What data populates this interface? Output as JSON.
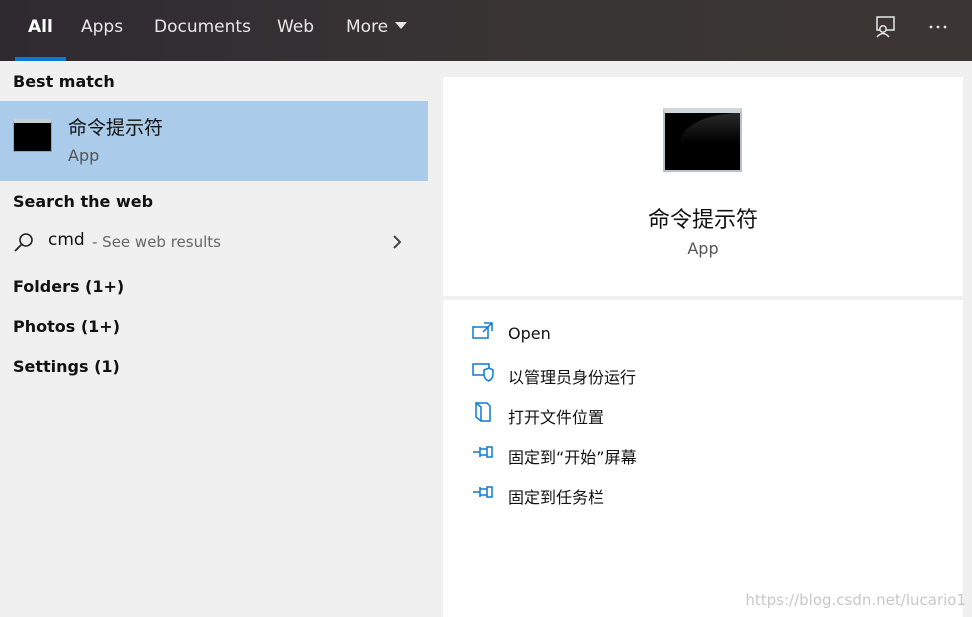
{
  "tabs": [
    {
      "label": "All",
      "active": true
    },
    {
      "label": "Apps"
    },
    {
      "label": "Documents"
    },
    {
      "label": "Web"
    },
    {
      "label": "More"
    }
  ],
  "top_icons": [
    "feedback-icon",
    "more-options-icon"
  ],
  "left": {
    "best_match_heading": "Best match",
    "best_match": {
      "title": "命令提示符",
      "subtitle": "App"
    },
    "web_heading": "Search the web",
    "web_result": {
      "query": "cmd",
      "hint": "- See web results"
    },
    "groups": [
      "Folders (1+)",
      "Photos (1+)",
      "Settings (1)"
    ]
  },
  "detail": {
    "title": "命令提示符",
    "subtitle": "App",
    "actions": [
      {
        "label": "Open",
        "icon": "open-icon"
      },
      {
        "label": "以管理员身份运行",
        "icon": "run-as-admin-icon"
      },
      {
        "label": "打开文件位置",
        "icon": "file-location-icon"
      },
      {
        "label": "固定到“开始”屏幕",
        "icon": "pin-start-icon"
      },
      {
        "label": "固定到任务栏",
        "icon": "pin-taskbar-icon"
      }
    ]
  },
  "watermark": "https://blog.csdn.net/lucario1",
  "colors": {
    "accent": "#0f78d4",
    "selection": "#aacbe9",
    "topbar": "#3a3535",
    "pane": "#f0f0f0"
  }
}
